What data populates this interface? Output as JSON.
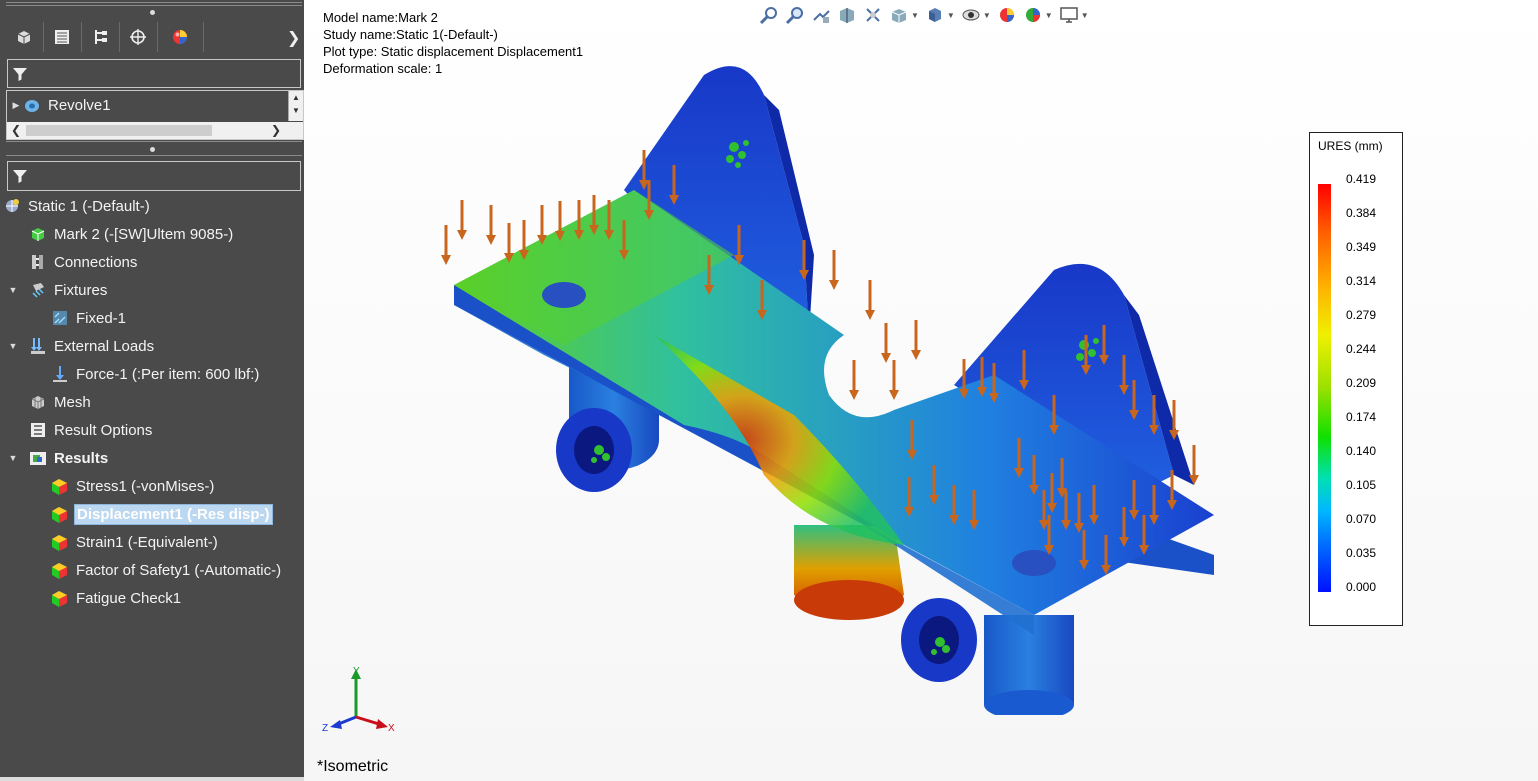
{
  "tree_top": {
    "items": [
      {
        "label": "Revolve1"
      }
    ]
  },
  "tree": {
    "items": [
      {
        "label": "Static 1 (-Default-)"
      },
      {
        "label": "Mark 2 (-[SW]Ultem 9085-)"
      },
      {
        "label": "Connections"
      },
      {
        "label": "Fixtures"
      },
      {
        "label": "Fixed-1"
      },
      {
        "label": "External Loads"
      },
      {
        "label": "Force-1 (:Per item: 600 lbf:)"
      },
      {
        "label": "Mesh"
      },
      {
        "label": "Result Options"
      },
      {
        "label": "Results"
      },
      {
        "label": "Stress1 (-vonMises-)"
      },
      {
        "label": "Displacement1 (-Res disp-)"
      },
      {
        "label": "Strain1 (-Equivalent-)"
      },
      {
        "label": "Factor of Safety1 (-Automatic-)"
      },
      {
        "label": "Fatigue Check1"
      }
    ]
  },
  "viewport": {
    "info": {
      "model": "Model name:Mark 2",
      "study": "Study name:Static 1(-Default-)",
      "plot": "Plot type: Static displacement Displacement1",
      "scale": "Deformation scale: 1"
    },
    "view_name": "*Isometric",
    "triad": {
      "x": "X",
      "y": "Y",
      "z": "Z"
    }
  },
  "legend": {
    "title": "URES (mm)",
    "ticks": [
      "0.419",
      "0.384",
      "0.349",
      "0.314",
      "0.279",
      "0.244",
      "0.209",
      "0.174",
      "0.140",
      "0.105",
      "0.070",
      "0.035",
      "0.000"
    ],
    "max_color": "#ff0000",
    "min_color": "#0010ff"
  },
  "colors": {
    "panel_bg": "#4a4a4a",
    "selection": "#bcd7f0",
    "arrow": "#c8661e",
    "model_blue": "#1a3fd0"
  }
}
